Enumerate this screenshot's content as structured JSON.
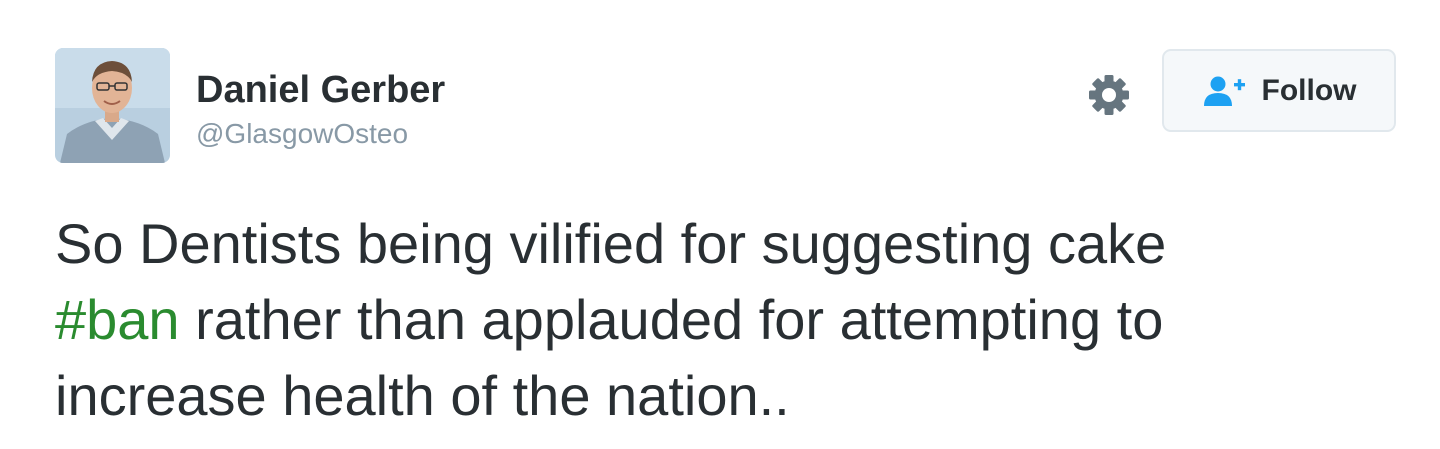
{
  "author": {
    "name": "Daniel Gerber",
    "handle": "@GlasgowOsteo"
  },
  "actions": {
    "settings_icon": "gear-icon",
    "follow_icon": "user-plus-icon",
    "follow_label": "Follow"
  },
  "tweet": {
    "line1": "So Dentists being vilified for suggesting cake",
    "line2_hashtag": "#ban",
    "line2_rest": " rather than applauded for attempting to",
    "line3": "increase health of the nation.."
  },
  "colors": {
    "text": "#292f33",
    "secondary": "#8899a6",
    "hashtag": "#2a8b2f",
    "follow_icon": "#1da1f2",
    "button_border": "#e1e8ed",
    "button_bg": "#f5f8fa"
  }
}
